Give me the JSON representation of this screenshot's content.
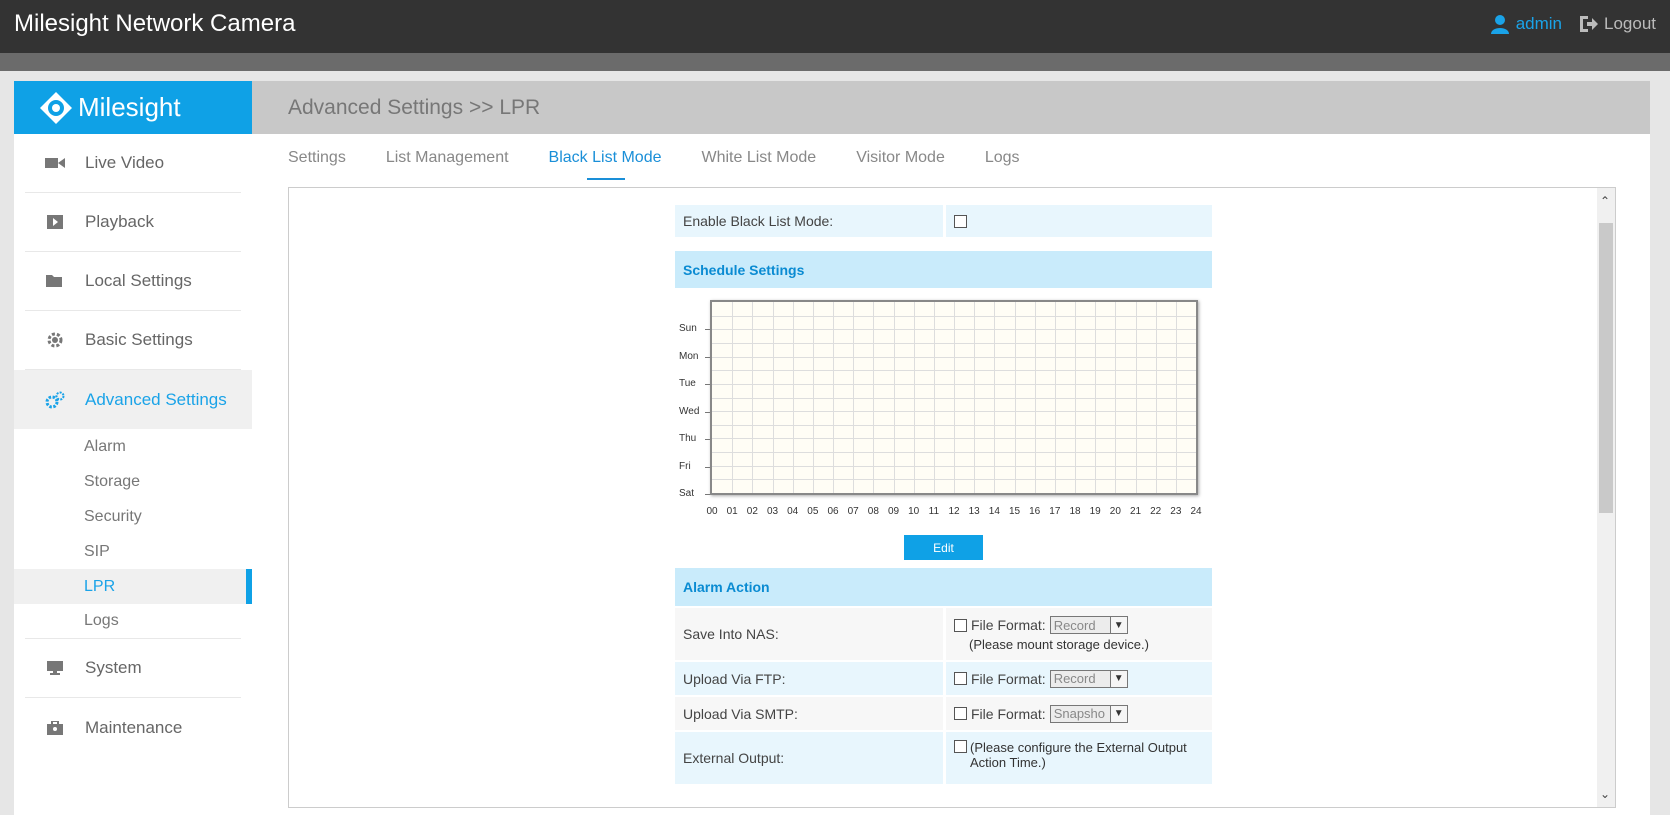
{
  "header": {
    "title": "Milesight Network Camera",
    "user": "admin",
    "logout": "Logout"
  },
  "sidebar": {
    "logo": "Milesight",
    "items": [
      {
        "label": "Live Video",
        "icon": "video-camera-icon"
      },
      {
        "label": "Playback",
        "icon": "play-icon"
      },
      {
        "label": "Local Settings",
        "icon": "folder-icon"
      },
      {
        "label": "Basic Settings",
        "icon": "gear-icon"
      },
      {
        "label": "Advanced Settings",
        "icon": "gears-icon"
      },
      {
        "label": "System",
        "icon": "monitor-icon"
      },
      {
        "label": "Maintenance",
        "icon": "toolbox-icon"
      }
    ],
    "subitems": [
      "Alarm",
      "Storage",
      "Security",
      "SIP",
      "LPR",
      "Logs"
    ]
  },
  "main": {
    "breadcrumb": "Advanced Settings >> LPR",
    "tabs": [
      "Settings",
      "List Management",
      "Black List Mode",
      "White List Mode",
      "Visitor Mode",
      "Logs"
    ],
    "active_tab": "Black List Mode"
  },
  "form": {
    "enable_label": "Enable Black List Mode:",
    "schedule_title": "Schedule Settings",
    "days": [
      "Sun",
      "Mon",
      "Tue",
      "Wed",
      "Thu",
      "Fri",
      "Sat"
    ],
    "hours": [
      "00",
      "01",
      "02",
      "03",
      "04",
      "05",
      "06",
      "07",
      "08",
      "09",
      "10",
      "11",
      "12",
      "13",
      "14",
      "15",
      "16",
      "17",
      "18",
      "19",
      "20",
      "21",
      "22",
      "23",
      "24"
    ],
    "edit_label": "Edit",
    "alarm_title": "Alarm Action",
    "nas_label": "Save Into NAS:",
    "ftp_label": "Upload Via FTP:",
    "smtp_label": "Upload Via SMTP:",
    "ext_label": "External Output:",
    "file_format_label": "File Format:",
    "nas_format": "Record",
    "ftp_format": "Record",
    "smtp_format": "Snapsho",
    "nas_note": "(Please mount storage device.)",
    "ext_note": "(Please configure the External Output Action Time.)"
  }
}
